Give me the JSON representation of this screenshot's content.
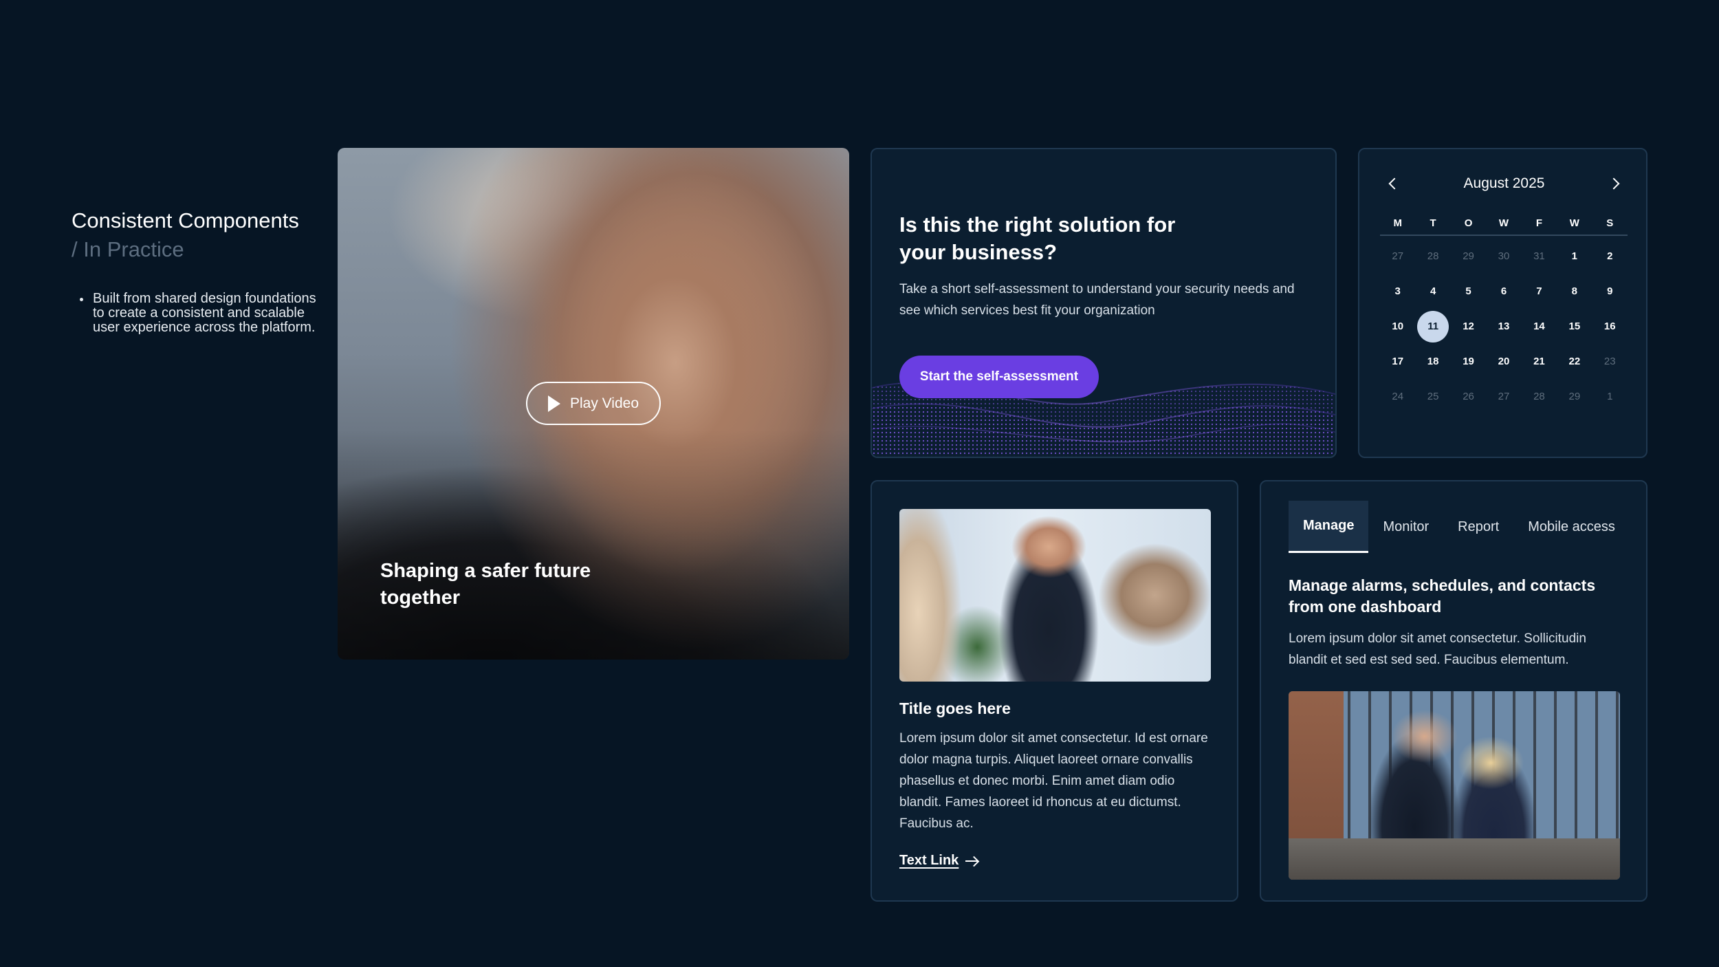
{
  "intro": {
    "title": "Consistent Components",
    "subtitle": "/ In Practice",
    "bullets": [
      "Built from shared design foundations to create a consistent and scalable user experience across the platform."
    ]
  },
  "video_card": {
    "play_label": "Play Video",
    "play_icon": "play-icon",
    "caption": "Shaping a safer future together"
  },
  "assessment": {
    "title": "Is this the right solution for your business?",
    "text": "Take a short self-assessment to understand your security needs and see which services best fit your organization",
    "button": "Start the self-assessment",
    "accent": "#6a3ee2"
  },
  "calendar": {
    "month": "August 2025",
    "prev_icon": "chevron-left-icon",
    "next_icon": "chevron-right-icon",
    "weekdays": [
      "M",
      "T",
      "O",
      "W",
      "F",
      "W",
      "S"
    ],
    "weeks": [
      [
        "27",
        "28",
        "29",
        "30",
        "31",
        "1",
        "2"
      ],
      [
        "3",
        "4",
        "5",
        "6",
        "7",
        "8",
        "9"
      ],
      [
        "10",
        "11",
        "12",
        "13",
        "14",
        "15",
        "16"
      ],
      [
        "17",
        "18",
        "19",
        "20",
        "21",
        "22",
        "23"
      ],
      [
        "24",
        "25",
        "26",
        "27",
        "28",
        "29",
        "1"
      ]
    ],
    "selected": "11",
    "selected_color": "#c9d8ec"
  },
  "article": {
    "title": "Title goes here",
    "text": "Lorem ipsum dolor sit amet consectetur. Id est ornare dolor magna turpis. Aliquet laoreet ornare convallis phasellus et donec morbi. Enim amet diam odio blandit. Fames laoreet id rhoncus at eu dictumst. Faucibus ac.",
    "link": "Text Link",
    "link_icon": "arrow-right-icon"
  },
  "tabs_card": {
    "tabs": [
      {
        "label": "Manage"
      },
      {
        "label": "Monitor"
      },
      {
        "label": "Report"
      },
      {
        "label": "Mobile access"
      }
    ],
    "active_tab": "Manage",
    "heading": "Manage alarms, schedules, and contacts from one dashboard",
    "text": "Lorem ipsum dolor sit amet consectetur. Sollicitudin blandit et sed est sed sed. Faucibus elementum."
  },
  "colors": {
    "background": "#061524",
    "card": "#0b1e30",
    "card_border": "#1f3850"
  }
}
